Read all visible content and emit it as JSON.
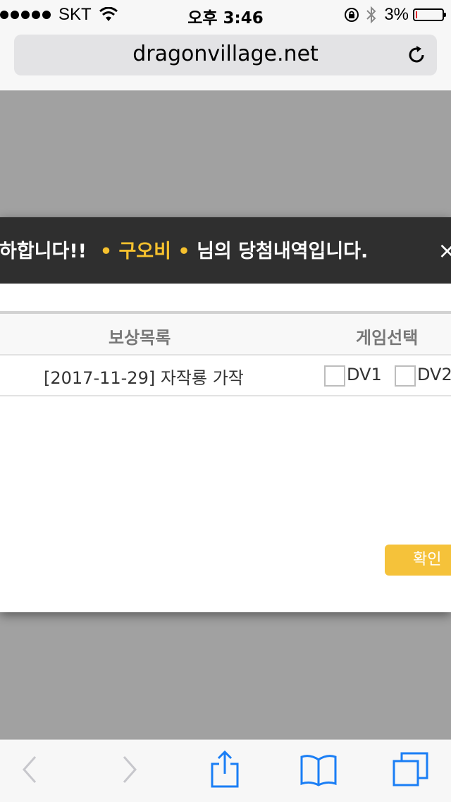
{
  "status_bar": {
    "carrier": "SKT",
    "time": "오후 3:46",
    "battery": "3%",
    "battery_level": 0.03
  },
  "address_bar": {
    "url": "dragonvillage.net"
  },
  "modal": {
    "header_prefix": "하합니다!!",
    "header_name": "• 구오비 •",
    "header_suffix": "님의 당첨내역입니다.",
    "columns": {
      "reward": "보상목록",
      "game": "게임선택"
    },
    "rows": [
      {
        "reward": "[2017-11-29] 자작룡 가작",
        "option1": "DV1",
        "option2": "DV2"
      }
    ],
    "confirm_label": "확인"
  },
  "colors": {
    "accent": "#f5c23a",
    "header_bg": "#2f2f2f",
    "name": "#f6c12e",
    "ios_blue": "#1a7ef5"
  }
}
